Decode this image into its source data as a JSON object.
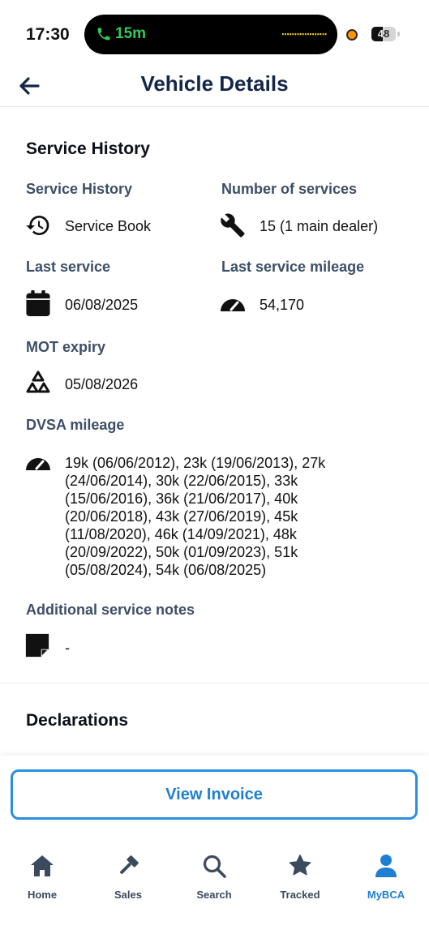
{
  "status_bar": {
    "time": "17:30",
    "call_duration": "15m",
    "battery": "48",
    "battery_level": 0.48,
    "call_color": "#34c759"
  },
  "header": {
    "title": "Vehicle Details",
    "back_icon": "arrow-left-icon"
  },
  "service_history": {
    "section_title": "Service History",
    "fields": {
      "service_history": {
        "label": "Service History",
        "value": "Service Book",
        "icon": "history-icon"
      },
      "number_of_services": {
        "label": "Number of services",
        "value": "15 (1 main dealer)",
        "icon": "wrench-icon"
      },
      "last_service": {
        "label": "Last service",
        "value": "06/08/2025",
        "icon": "calendar-icon"
      },
      "last_service_mileage": {
        "label": "Last service mileage",
        "value": "54,170",
        "icon": "speedometer-icon"
      },
      "mot_expiry": {
        "label": "MOT expiry",
        "value": "05/08/2026",
        "icon": "mot-triangle-icon"
      },
      "dvsa_mileage": {
        "label": "DVSA mileage",
        "icon": "speedometer-icon",
        "lines": [
          "19k (06/06/2012), 23k (19/06/2013), 27k",
          "(24/06/2014), 30k (22/06/2015), 33k",
          "(15/06/2016), 36k (21/06/2017), 40k",
          "(20/06/2018), 43k (27/06/2019), 45k",
          "(11/08/2020), 46k (14/09/2021), 48k",
          "(20/09/2022), 50k (01/09/2023), 51k",
          "(05/08/2024), 54k (06/08/2025)"
        ]
      },
      "additional_notes": {
        "label": "Additional service notes",
        "value": "-",
        "icon": "sticky-note-icon"
      }
    }
  },
  "declarations": {
    "section_title": "Declarations"
  },
  "actions": {
    "view_invoice": "View Invoice"
  },
  "tabbar": {
    "active_color": "#1f7fd3",
    "items": [
      {
        "label": "Home",
        "icon": "home-icon"
      },
      {
        "label": "Sales",
        "icon": "gavel-icon"
      },
      {
        "label": "Search",
        "icon": "search-icon"
      },
      {
        "label": "Tracked",
        "icon": "star-icon"
      },
      {
        "label": "MyBCA",
        "icon": "user-icon",
        "active": true
      }
    ]
  }
}
